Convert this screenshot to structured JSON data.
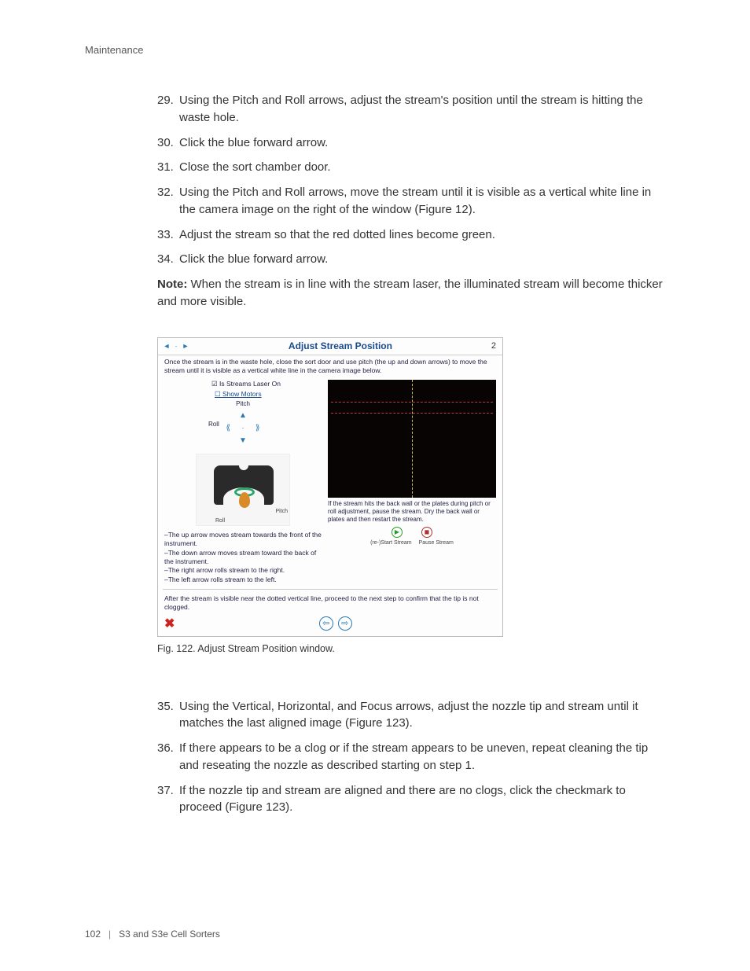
{
  "header": {
    "section": "Maintenance"
  },
  "stepsA": [
    {
      "n": "29.",
      "t": "Using the Pitch and Roll arrows, adjust the stream's position until the stream is hitting the waste hole."
    },
    {
      "n": "30.",
      "t": "Click the blue forward arrow."
    },
    {
      "n": "31.",
      "t": "Close the sort chamber door."
    },
    {
      "n": "32.",
      "t": "Using the Pitch and Roll arrows, move the stream until it is visible as a vertical white line in the camera image on the right of the window (Figure 12)."
    },
    {
      "n": "33.",
      "t": "Adjust the stream so that the red dotted lines become green."
    },
    {
      "n": "34.",
      "t": "Click the blue forward arrow."
    }
  ],
  "note": {
    "label": "Note:",
    "text": "  When the stream is in line with the stream laser, the illuminated stream will become thicker and more visible."
  },
  "win": {
    "title": "Adjust Stream Position",
    "stepNum": "2",
    "instr": "Once the stream is in the waste hole, close the sort door and use pitch (the up and down arrows) to move the stream until it is visible as a vertical white line in the camera image below.",
    "chkLaser": "Is Streams Laser On",
    "chkMotors": "Show Motors",
    "pitchLabel": "Pitch",
    "rollLabel": "Roll",
    "illusPitch": "Pitch",
    "illusRoll": "Roll",
    "camCaption": "If the stream hits the back wall or the plates during pitch or roll adjustment, pause the stream.  Dry the back wall or plates and then restart the stream.",
    "restartLabel": "(re-)Start Stream",
    "pauseLabel": "Pause Stream",
    "hints": [
      "–The up arrow moves stream towards the front of the instrument.",
      "–The down arrow moves stream toward the back of the instrument.",
      "–The right arrow rolls stream to the right.",
      "–The left arrow rolls stream to the left."
    ],
    "final": "After the stream is visible near the dotted vertical line, proceed to the next step to confirm that the tip is not clogged."
  },
  "figCaption": "Fig. 122. Adjust Stream Position window.",
  "stepsB": [
    {
      "n": "35.",
      "t": "Using the Vertical, Horizontal, and Focus arrows, adjust the nozzle tip and stream until it matches the last aligned image (Figure 123)."
    },
    {
      "n": "36.",
      "t": "If there appears to be a clog or if the stream appears to be uneven, repeat cleaning the tip and reseating the nozzle as described starting on step 1."
    },
    {
      "n": "37.",
      "t": "If the nozzle tip and stream are aligned and there are no clogs, click the checkmark to proceed (Figure 123)."
    }
  ],
  "footer": {
    "page": "102",
    "product": "S3 and S3e Cell Sorters"
  }
}
